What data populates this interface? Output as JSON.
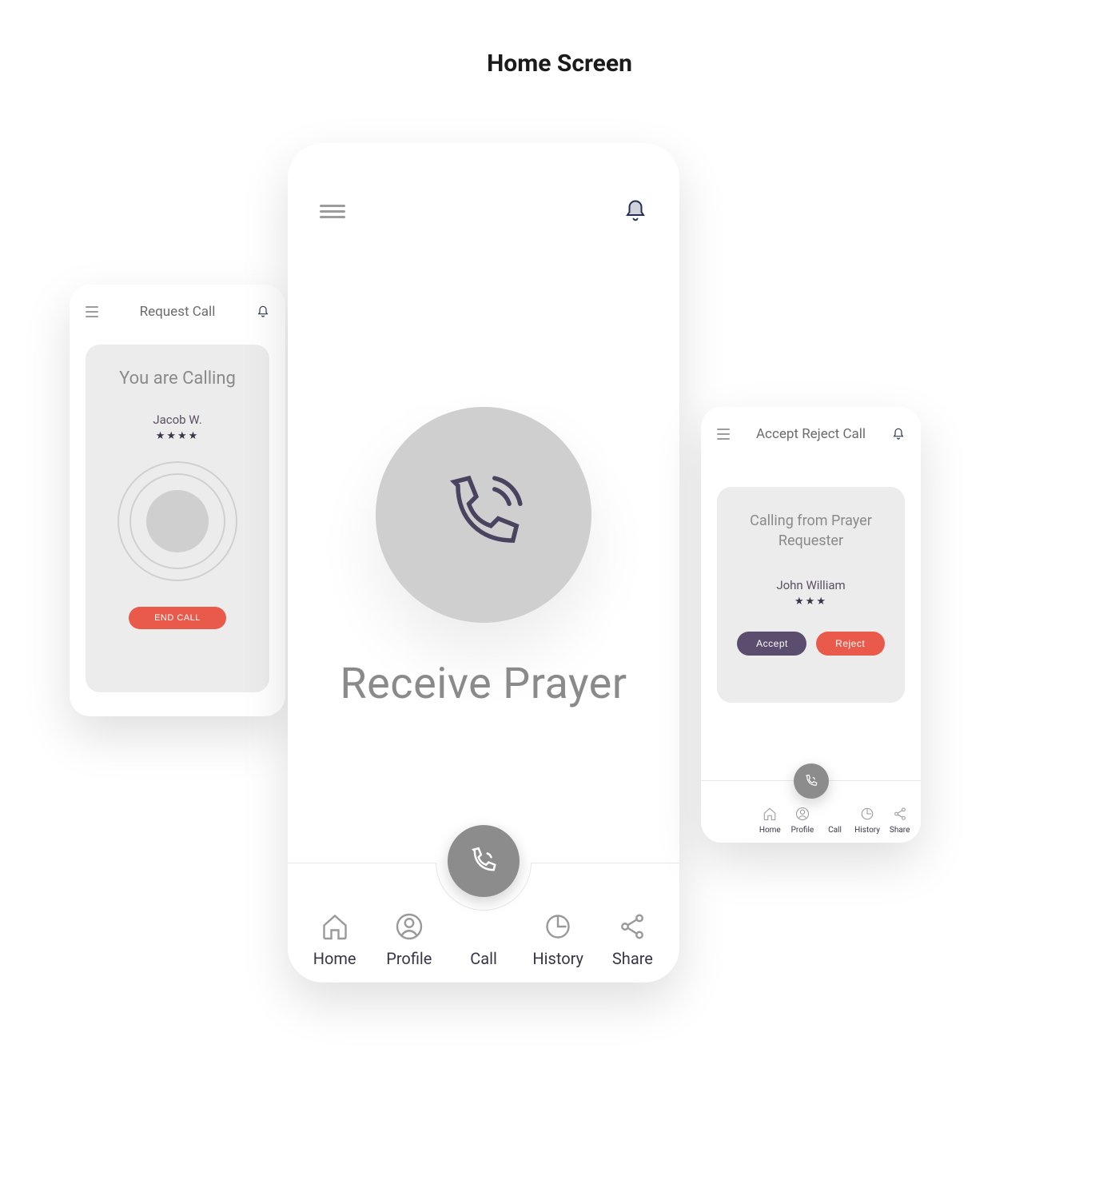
{
  "page_title": "Home Screen",
  "center": {
    "cta": "Receive Prayer",
    "nav": [
      "Home",
      "Profile",
      "Call",
      "History",
      "Share"
    ]
  },
  "left": {
    "header": "Request Call",
    "card_title": "You are Calling",
    "caller": "Jacob W.",
    "stars": "★★★★",
    "end_call": "END CALL"
  },
  "right": {
    "header": "Accept Reject Call",
    "card_title": "Calling from Prayer Requester",
    "caller": "John William",
    "stars": "★★★",
    "accept": "Accept",
    "reject": "Reject",
    "nav": [
      "Home",
      "Profile",
      "Call",
      "History",
      "Share"
    ]
  }
}
